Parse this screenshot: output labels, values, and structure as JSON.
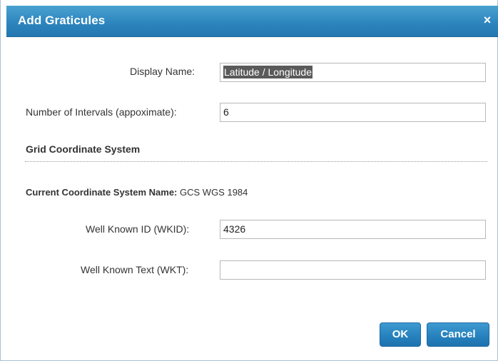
{
  "dialog": {
    "title": "Add Graticules",
    "close_icon": "close-icon",
    "close_glyph": "×"
  },
  "form": {
    "display_name_label": "Display Name:",
    "display_name_value": "Latitude / Longitude",
    "intervals_label": "Number of Intervals (appoximate):",
    "intervals_value": "6"
  },
  "grid_section": {
    "heading": "Grid Coordinate System",
    "current_cs_label": "Current Coordinate System Name:",
    "current_cs_value": "GCS WGS 1984",
    "wkid_label": "Well Known ID (WKID):",
    "wkid_value": "4326",
    "wkt_label": "Well Known Text (WKT):",
    "wkt_value": ""
  },
  "buttons": {
    "ok_label": "OK",
    "cancel_label": "Cancel"
  },
  "colors": {
    "title_bar": "#2d86be",
    "button": "#2580bd"
  }
}
